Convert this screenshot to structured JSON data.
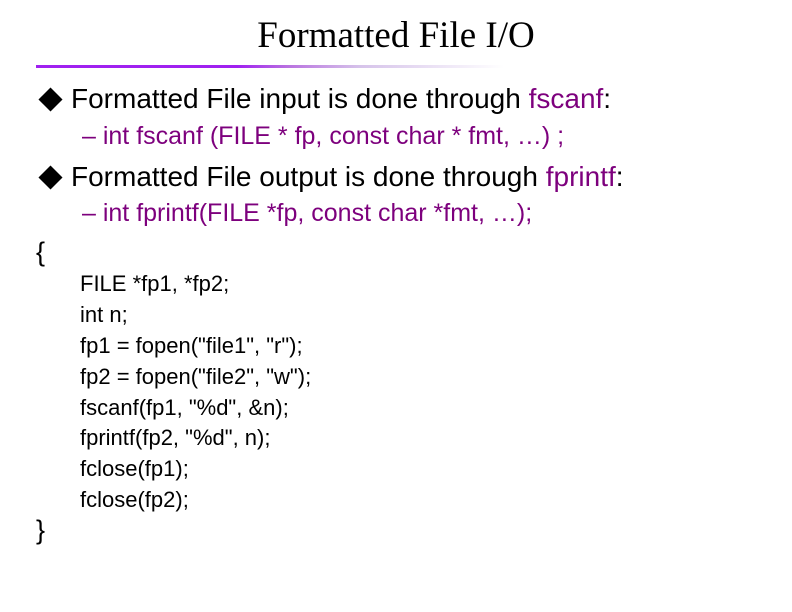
{
  "title": "Formatted File I/O",
  "bullet1": {
    "prefix": "Formatted File input is done through ",
    "accent": "fscanf",
    "suffix": ":"
  },
  "sub1": "– int fscanf (FILE * fp, const char * fmt, …) ;",
  "bullet2": {
    "prefix": "Formatted File output is done through ",
    "accent": "fprintf",
    "suffix": ":"
  },
  "sub2": "– int fprintf(FILE *fp, const char *fmt, …);",
  "brace_open": "{",
  "code": {
    "l1": "FILE *fp1, *fp2;",
    "l2": "int n;",
    "l3": "fp1 = fopen(\"file1\", \"r\");",
    "l4": "fp2 = fopen(\"file2\", \"w\");",
    "l5": "fscanf(fp1, \"%d\", &n);",
    "l6": "fprintf(fp2, \"%d\", n);",
    "l7": "fclose(fp1);",
    "l8": "fclose(fp2);"
  },
  "brace_close": "}"
}
